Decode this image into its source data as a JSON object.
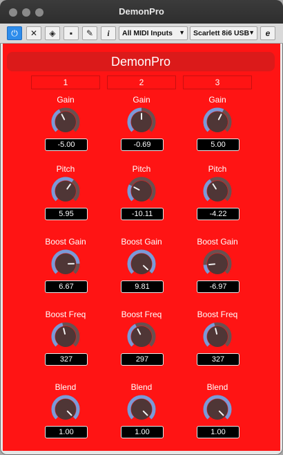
{
  "window": {
    "title": "DemonPro"
  },
  "toolbar": {
    "buttons": [
      {
        "icon": "power-icon",
        "glyph": "⏻"
      },
      {
        "icon": "mute-icon",
        "glyph": "✕"
      },
      {
        "icon": "compare-icon",
        "glyph": "◈"
      },
      {
        "icon": "save-icon",
        "glyph": "▪"
      },
      {
        "icon": "edit-icon",
        "glyph": "✎"
      },
      {
        "icon": "info-icon",
        "glyph": "i"
      }
    ],
    "midi_input": "All MIDI Inputs",
    "audio_device": "Scarlett 8i6 USB",
    "e_label": "e"
  },
  "plugin": {
    "title": "DemonPro",
    "columns": [
      "1",
      "2",
      "3"
    ],
    "rows": [
      {
        "label": "Gain",
        "values": [
          "-5.00",
          "-0.69",
          "5.00"
        ],
        "levels": [
          0.4,
          0.5,
          0.6
        ]
      },
      {
        "label": "Pitch",
        "values": [
          "5.95",
          "-10.11",
          "-4.22"
        ],
        "levels": [
          0.63,
          0.27,
          0.38
        ]
      },
      {
        "label": "Boost Gain",
        "values": [
          "6.67",
          "9.81",
          "-6.97"
        ],
        "levels": [
          0.83,
          0.99,
          0.15
        ]
      },
      {
        "label": "Boost Freq",
        "values": [
          "327",
          "297",
          "327"
        ],
        "levels": [
          0.45,
          0.4,
          0.45
        ]
      },
      {
        "label": "Blend",
        "values": [
          "1.00",
          "1.00",
          "1.00"
        ],
        "levels": [
          1.0,
          1.0,
          1.0
        ]
      }
    ]
  },
  "colors": {
    "panel": "#ff1414",
    "knob_fill": "#4f3636",
    "knob_arc": "#7a9ad8",
    "knob_track": "#6a5050"
  }
}
